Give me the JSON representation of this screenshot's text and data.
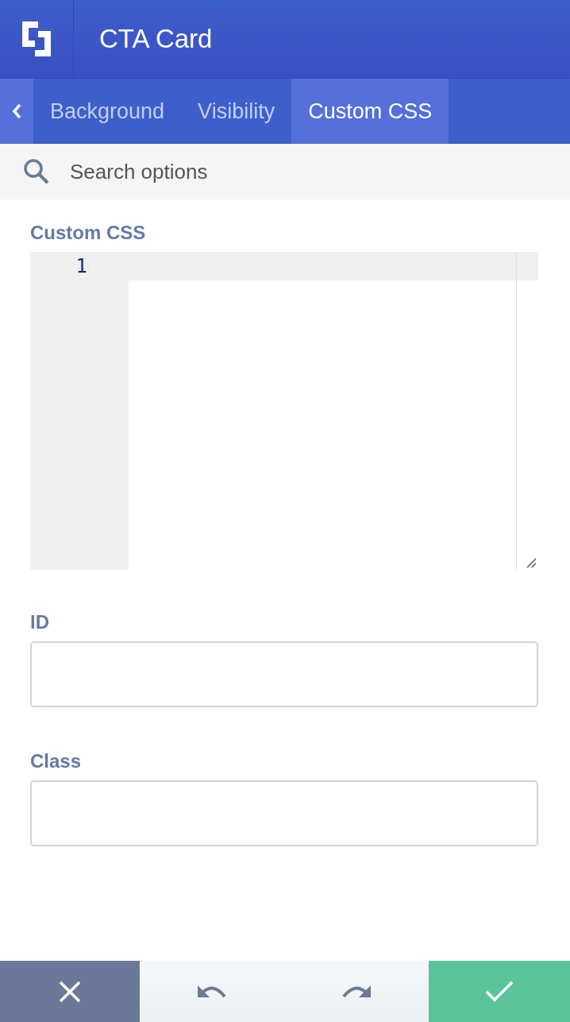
{
  "header": {
    "title": "CTA Card"
  },
  "tabs": [
    {
      "label": "Background",
      "selected": false
    },
    {
      "label": "Visibility",
      "selected": false
    },
    {
      "label": "Custom CSS",
      "selected": true
    }
  ],
  "search": {
    "placeholder": "Search options"
  },
  "code_editor": {
    "label": "Custom CSS",
    "line_numbers": [
      "1"
    ]
  },
  "fields": [
    {
      "label": "ID"
    },
    {
      "label": "Class"
    }
  ]
}
